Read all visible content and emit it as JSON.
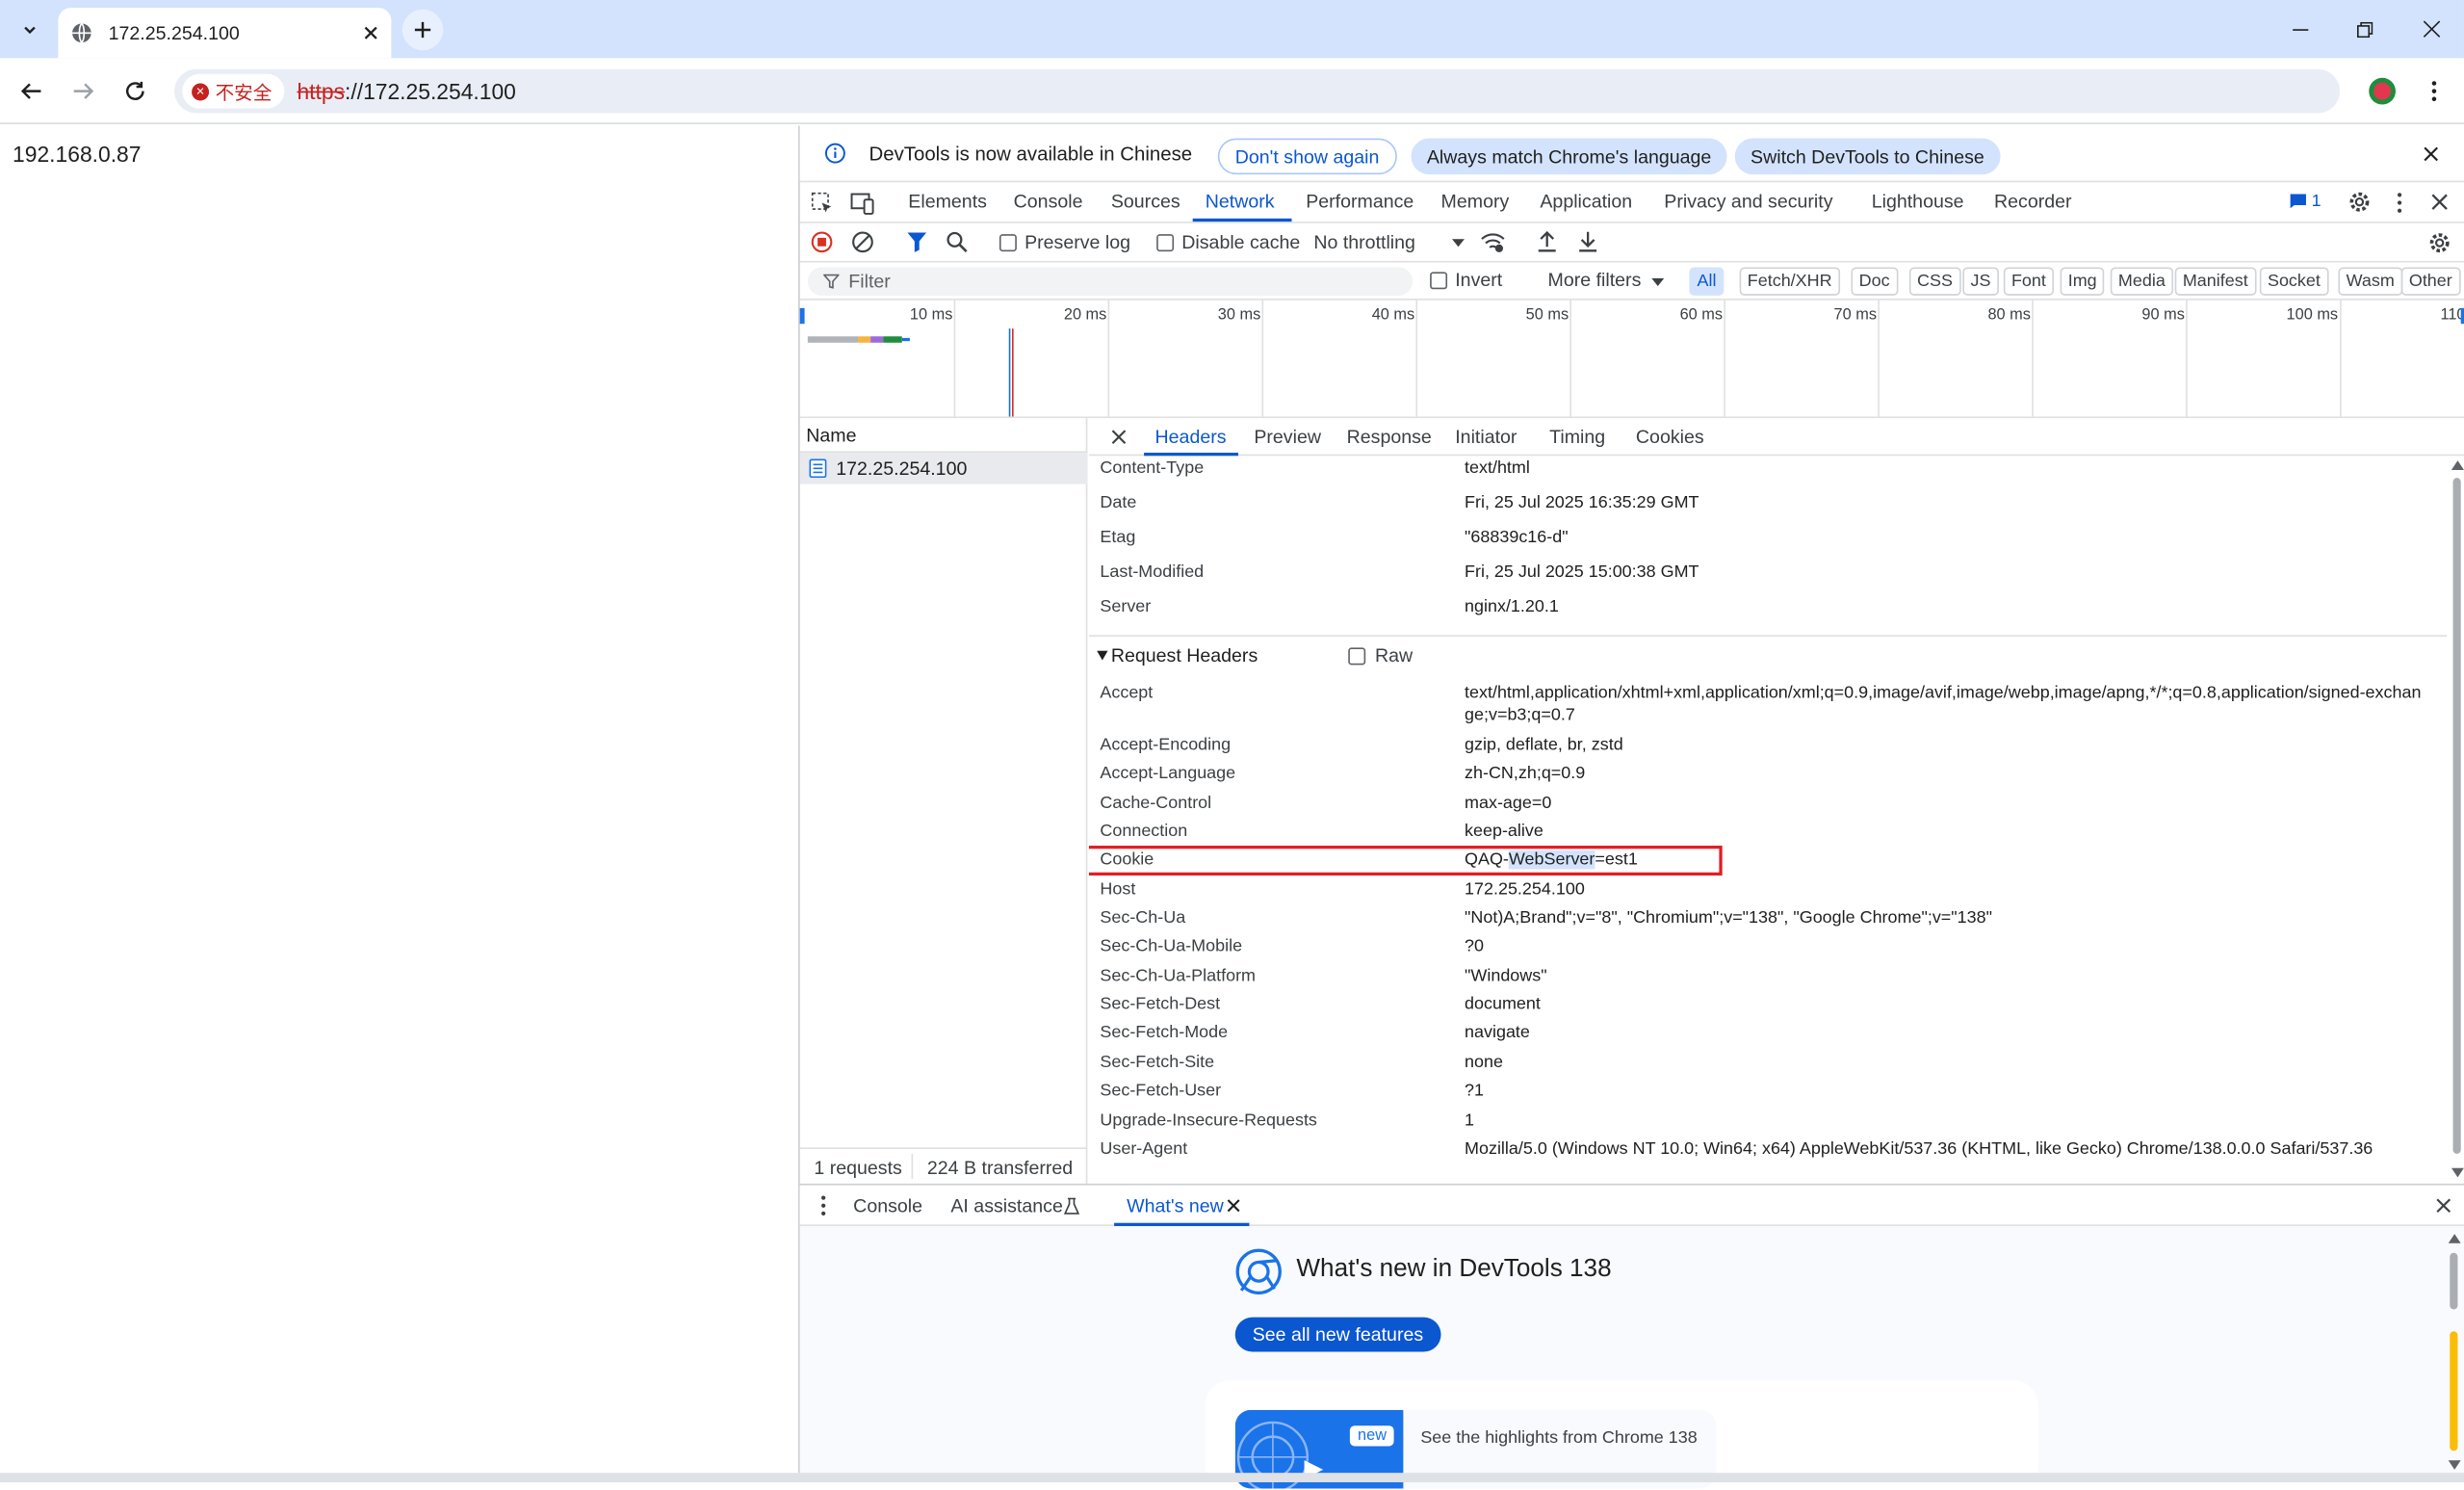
{
  "browser": {
    "tab_title": "172.25.254.100",
    "security_label": "不安全",
    "url_scheme": "https",
    "url_rest": "://172.25.254.100"
  },
  "page": {
    "body_text": "192.168.0.87"
  },
  "devtools": {
    "infobar": {
      "message": "DevTools is now available in Chinese",
      "dont_show": "Don't show again",
      "always_match": "Always match Chrome's language",
      "switch": "Switch DevTools to Chinese"
    },
    "main_tabs": [
      "Elements",
      "Console",
      "Sources",
      "Network",
      "Performance",
      "Memory",
      "Application",
      "Privacy and security",
      "Lighthouse",
      "Recorder"
    ],
    "issues_count": "1",
    "network_toolbar": {
      "preserve_log": "Preserve log",
      "disable_cache": "Disable cache",
      "throttling": "No throttling"
    },
    "filter": {
      "placeholder": "Filter",
      "invert": "Invert",
      "more_filters": "More filters",
      "types": [
        "All",
        "Fetch/XHR",
        "Doc",
        "CSS",
        "JS",
        "Font",
        "Img",
        "Media",
        "Manifest",
        "Socket",
        "Wasm",
        "Other"
      ]
    },
    "overview_ticks": [
      "10 ms",
      "20 ms",
      "30 ms",
      "40 ms",
      "50 ms",
      "60 ms",
      "70 ms",
      "80 ms",
      "90 ms",
      "100 ms",
      "110"
    ],
    "requests": {
      "column_name": "Name",
      "rows": [
        "172.25.254.100"
      ],
      "status_count": "1 requests",
      "status_transferred": "224 B transferred"
    },
    "detail_tabs": [
      "Headers",
      "Preview",
      "Response",
      "Initiator",
      "Timing",
      "Cookies"
    ],
    "response_headers": [
      {
        "name": "Content-Type",
        "value": "text/html"
      },
      {
        "name": "Date",
        "value": "Fri, 25 Jul 2025 16:35:29 GMT"
      },
      {
        "name": "Etag",
        "value": "\"68839c16-d\""
      },
      {
        "name": "Last-Modified",
        "value": "Fri, 25 Jul 2025 15:00:38 GMT"
      },
      {
        "name": "Server",
        "value": "nginx/1.20.1"
      }
    ],
    "request_section_title": "Request Headers",
    "raw_label": "Raw",
    "request_headers": [
      {
        "name": "Accept",
        "value": "text/html,application/xhtml+xml,application/xml;q=0.9,image/avif,image/webp,image/apng,*/*;q=0.8,application/signed-exchange;v=b3;q=0.7"
      },
      {
        "name": "Accept-Encoding",
        "value": "gzip, deflate, br, zstd"
      },
      {
        "name": "Accept-Language",
        "value": "zh-CN,zh;q=0.9"
      },
      {
        "name": "Cache-Control",
        "value": "max-age=0"
      },
      {
        "name": "Connection",
        "value": "keep-alive"
      },
      {
        "name": "Cookie",
        "value": "QAQ-WebServer=est1"
      },
      {
        "name": "Host",
        "value": "172.25.254.100"
      },
      {
        "name": "Sec-Ch-Ua",
        "value": "\"Not)A;Brand\";v=\"8\", \"Chromium\";v=\"138\", \"Google Chrome\";v=\"138\""
      },
      {
        "name": "Sec-Ch-Ua-Mobile",
        "value": "?0"
      },
      {
        "name": "Sec-Ch-Ua-Platform",
        "value": "\"Windows\""
      },
      {
        "name": "Sec-Fetch-Dest",
        "value": "document"
      },
      {
        "name": "Sec-Fetch-Mode",
        "value": "navigate"
      },
      {
        "name": "Sec-Fetch-Site",
        "value": "none"
      },
      {
        "name": "Sec-Fetch-User",
        "value": "?1"
      },
      {
        "name": "Upgrade-Insecure-Requests",
        "value": "1"
      },
      {
        "name": "User-Agent",
        "value": "Mozilla/5.0 (Windows NT 10.0; Win64; x64) AppleWebKit/537.36 (KHTML, like Gecko) Chrome/138.0.0.0 Safari/537.36"
      }
    ],
    "cookie_parts": {
      "pre": "QAQ-",
      "highlight": "WebServer",
      "post": "=est1"
    },
    "drawer": {
      "tabs": [
        "Console",
        "AI assistance",
        "What's new"
      ],
      "heading": "What's new in DevTools 138",
      "see_all": "See all new features",
      "badge": "new",
      "highlight_text": "See the highlights from Chrome 138"
    },
    "colors": {
      "accent": "#0b57d0",
      "highlight_box": "#e51c23",
      "tab_strip": "#d3e3fd"
    }
  }
}
